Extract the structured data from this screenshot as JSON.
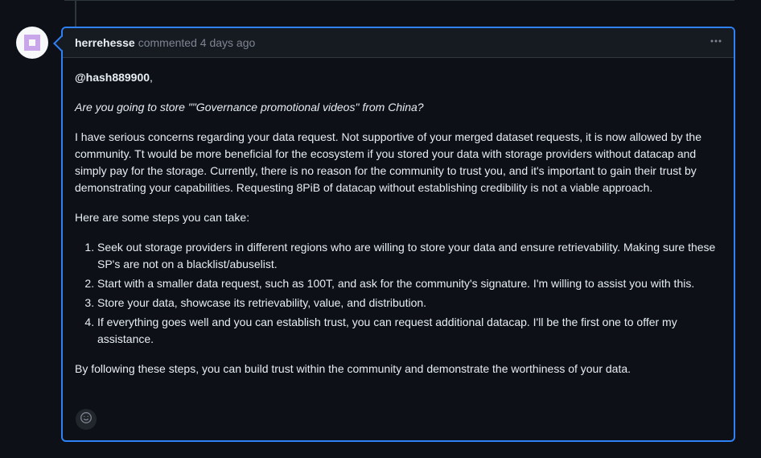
{
  "comment": {
    "author": "herrehesse",
    "action": "commented",
    "time": "4 days ago",
    "menu_icon": "kebab-horizontal-icon",
    "mention": "@hash889900",
    "mention_suffix": ",",
    "question": "Are you going to store \"\"Governance promotional videos\" from China?",
    "paragraph1": "I have serious concerns regarding your data request. Not supportive of your merged dataset requests, it is now allowed by the community. Tt would be more beneficial for the ecosystem if you stored your data with storage providers without datacap and simply pay for the storage. Currently, there is no reason for the community to trust you, and it's important to gain their trust by demonstrating your capabilities. Requesting 8PiB of datacap without establishing credibility is not a viable approach.",
    "steps_intro": "Here are some steps you can take:",
    "steps": [
      "Seek out storage providers in different regions who are willing to store your data and ensure retrievability. Making sure these SP's are not on a blacklist/abuselist.",
      "Start with a smaller data request, such as 100T, and ask for the community's signature. I'm willing to assist you with this.",
      "Store your data, showcase its retrievability, value, and distribution.",
      "If everything goes well and you can establish trust, you can request additional datacap. I'll be the first one to offer my assistance."
    ],
    "conclusion": "By following these steps, you can build trust within the community and demonstrate the worthiness of your data.",
    "reaction_icon": "smiley-icon"
  },
  "colors": {
    "background": "#0d1117",
    "header_bg": "#161b22",
    "border_accent": "#2f81f7",
    "muted_text": "#7d8590",
    "text": "#e6edf3",
    "avatar_accent": "#c9a5e9"
  }
}
